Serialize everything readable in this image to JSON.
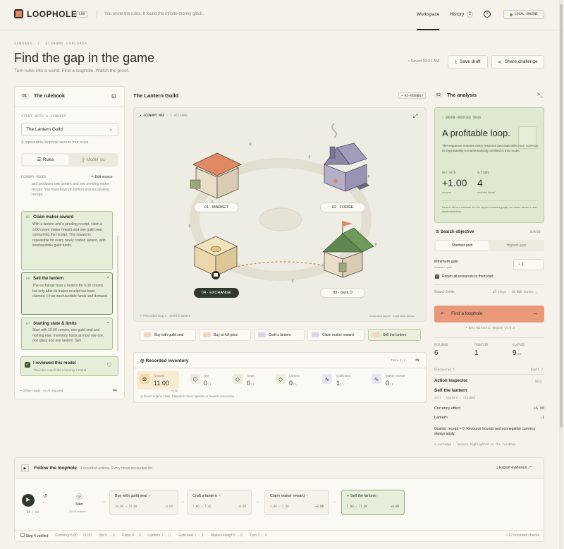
{
  "header": {
    "brand": "LOOPHOLE",
    "brand_tag": "LAB",
    "tagline": "You wrote the rules. It found the infinite-money glitch.",
    "nav_workspace": "Workspace",
    "nav_history": "History",
    "history_count": "2",
    "engine": "LOCAL ENGINE"
  },
  "breadcrumb": {
    "a": "SANDBOX",
    "b": "ECONOMY EXPLORER"
  },
  "hero": {
    "title": "Find the gap in the game",
    "title_dot": ".",
    "subtitle": "Turn rules into a world. Find a loophole. Watch the proof.",
    "saved": "Saved 03:51 AM",
    "save_draft": "Save draft",
    "share": "Share challenge"
  },
  "rulebook": {
    "num": "01",
    "title": "The rulebook",
    "start_label": "START WITH A SANDBOX",
    "selected": "The Lantern Guild",
    "desc": "A repeatable loophole across four rules",
    "tab_rules": "Rules",
    "tab_model": "Model",
    "tab_model_tag": "DSL",
    "section": "ECONOMY RULES",
    "edit": "Edit source",
    "rule_partial": "and produces one lantern and one pending maker receipt. You must have no lantern and no pending receipt.",
    "rule5_num": "05",
    "rule5_title": "Claim maker reward",
    "rule5_text": "With a lantern and a pending receipt, claim a 3.00 crown maker reward and one guild seal, consuming the receipt. This reward is repeatable for every newly crafted lantern, with inexhaustible guild funds.",
    "rule6_num": "06",
    "rule6_title": "Sell the lantern",
    "rule6_text": "The exchange buys a lantern for 6.00 crowns, but only after its maker receipt has been claimed. It has inexhaustible funds and demand.",
    "rule7_num": "07",
    "rule7_title": "Starting state & limits",
    "rule7_text": "Start with 10.00 crowns, one guild seal and nothing else. Inventory holds at most one ore, one glass and one lantern. Sell",
    "review_title": "I reviewed this model",
    "review_sub": "The rules match the economy I intend",
    "footer": "Offline ready · no AI required"
  },
  "map": {
    "title": "The Lantern Guild",
    "tag": "AI-FRIENDLY",
    "label": "ECONOMY MAP",
    "label_actions": "5 ACTIONS",
    "places": [
      "01 · MARKET",
      "02 · FORGE",
      "03 · GUILD",
      "04 · EXCHANGE"
    ],
    "footer_left": "Recorded step 4 · Sell the lantern",
    "footer_right": "Illustrative layout · input state below",
    "actions": [
      {
        "id": "01",
        "label": "Buy with guild seal"
      },
      {
        "id": "02",
        "label": "Buy at full price"
      },
      {
        "id": "03",
        "label": "Craft a lantern"
      },
      {
        "id": "04",
        "label": "Claim maker reward"
      },
      {
        "id": "05",
        "label": "Sell the lantern"
      }
    ]
  },
  "inventory": {
    "title": "Recorded inventory",
    "step": "Trace 4 / 4",
    "items": [
      {
        "name": "Crowns",
        "value": "11.00",
        "delta": "+6.00"
      },
      {
        "name": "Ore",
        "value": "0",
        "cap": "/ 1"
      },
      {
        "name": "Glass",
        "value": "0",
        "cap": "/ 1"
      },
      {
        "name": "Lantern",
        "value": "0",
        "cap": "/ 1"
      },
      {
        "name": "Guild seal",
        "value": "1",
        "cap": "/ 1"
      },
      {
        "name": "Maker receipt",
        "value": "0",
        "cap": "/ 1"
      }
    ],
    "footer": "Exact engine state. Playback never spends or invents resources."
  },
  "analysis": {
    "num": "02",
    "title": "The analysis",
    "trace_label": "ENGINE-VERIFIED TRACE",
    "headline": "A profitable loop.",
    "desc": "The sequence restores every resource and ends with more currency. Its repeatability is mathematically certified in this model.",
    "net_label": "NET GAIN",
    "net_value": "+1.00",
    "net_unit": "crowns",
    "actions_label": "ACTIONS",
    "actions_value": "4",
    "actions_unit": "shortest found",
    "note": "Search did not exhaust the full depth-bounded graph, we share about a new implementation.",
    "objective": "Search objective",
    "objective_tag": "DOMAIN",
    "opt1": "Shortest path",
    "opt2": "Highest gain",
    "min_gain": "Minimum gain",
    "min_gain_sub": "crowns / cycle",
    "min_gain_value": "1",
    "return_label": "Return all resources to their start",
    "limits_label": "Search limits",
    "limits_value": "≤8 steps · 50,000 states",
    "find_btn": "Find a loophole",
    "det": "Deterministic engine v1.0.4",
    "stats": [
      {
        "label": "EXPLORED",
        "value": "6"
      },
      {
        "label": "FRONTIER",
        "value": "1"
      },
      {
        "label": "ELAPSED",
        "value": "9",
        "unit": "ms"
      }
    ],
    "disc": "Discovered 5",
    "depth": "Depth 2",
    "inspector": "Action inspector",
    "inspector_tag": "SELL",
    "sell_title": "Sell the lantern",
    "sell_sub": "sell · lantern · claimed",
    "eff1_label": "Currency effect",
    "eff1_val": "+6.00",
    "eff2_label": "Lantern",
    "eff2_val": "-1",
    "guards": "Guards: receipt = 0. Resource bounds and nonnegative currency always apply.",
    "source": "exchange · lantern highlighted in the rulebook"
  },
  "follow": {
    "title": "Follow the loophole",
    "sub": "4 recorded actions. Every move accounted for.",
    "export": "Export evidence",
    "counter": "04 / 04",
    "start": "Start",
    "start_sub": "10.00 crowns",
    "steps": [
      {
        "label": "Buy with guild seal",
        "from": "10.00",
        "to": "10.00",
        "delta": "-0.00"
      },
      {
        "label": "Craft a lantern",
        "from": "7.00",
        "to": "7.00",
        "delta": "-0.00"
      },
      {
        "label": "Claim maker reward",
        "from": "2.00",
        "to": "5.00",
        "delta": "+3.00"
      },
      {
        "label": "Sell the lantern",
        "from": "5.00",
        "to": "11.00",
        "delta": "+6.00"
      }
    ]
  },
  "status": {
    "verified": "Step 4 verified",
    "items": [
      "Currency 5.00 → 11.00",
      "Ore 0 → 0",
      "Glass 0 → 0",
      "Lantern 1 → 0",
      "Guild seal 1 → 1",
      "Maker receipt 0 → 0",
      "Turn 3 → 4"
    ],
    "checks": "12 recorded checks"
  },
  "colors": {
    "accent": "#e08a63",
    "green": "#6e9158",
    "panel": "#e6eed9"
  }
}
